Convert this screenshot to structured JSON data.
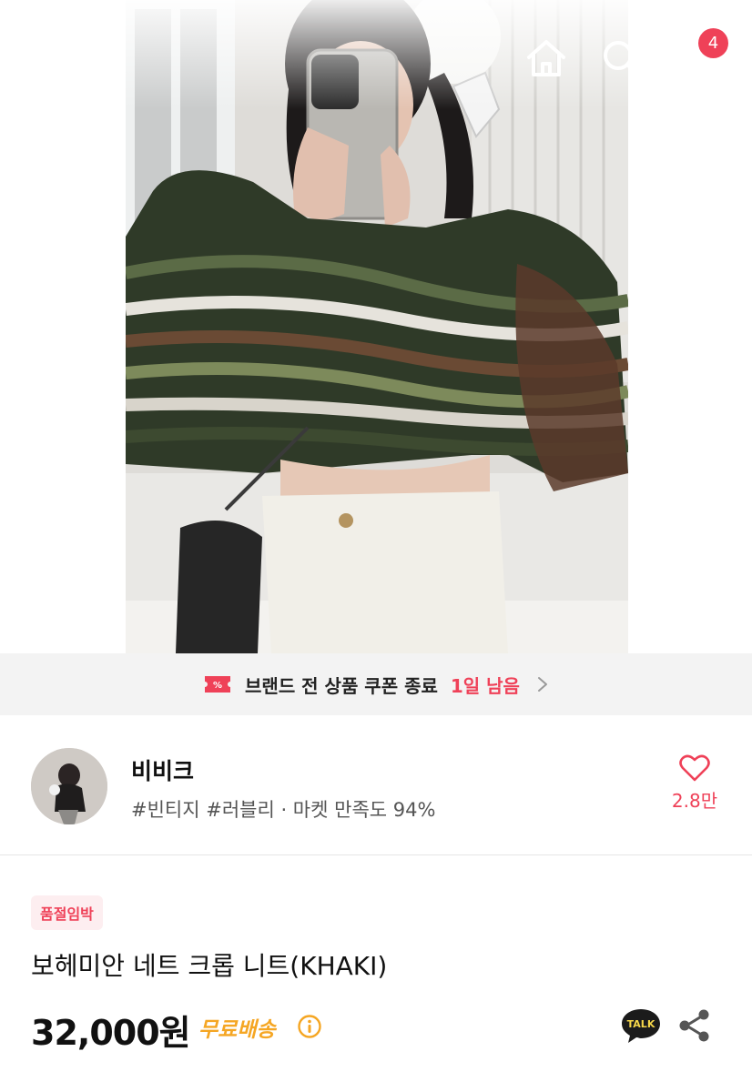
{
  "header": {
    "cart_count": "4"
  },
  "coupon_banner": {
    "text": "브랜드 전 상품 쿠폰 종료",
    "remaining": "1일 남음"
  },
  "shop": {
    "name": "비비크",
    "tags": "#빈티지 #러블리 · 마켓 만족도 94%",
    "favorite_count": "2.8만"
  },
  "product": {
    "badge": "품절임박",
    "title": "보헤미안 네트 크롭 니트(KHAKI)",
    "price": "32,000원",
    "shipping": "무료배송"
  },
  "colors": {
    "accent": "#ef4158",
    "shipping": "#f5a623"
  }
}
